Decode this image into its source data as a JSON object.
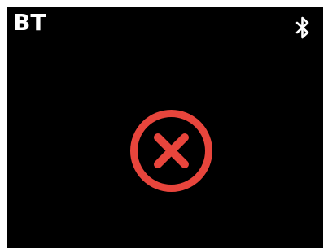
{
  "header": {
    "title": "BT",
    "bluetooth_icon": "bluetooth-icon"
  },
  "status": {
    "icon": "error-x-icon",
    "color": "#e8453c"
  },
  "colors": {
    "background": "#000000",
    "text": "#ffffff"
  }
}
